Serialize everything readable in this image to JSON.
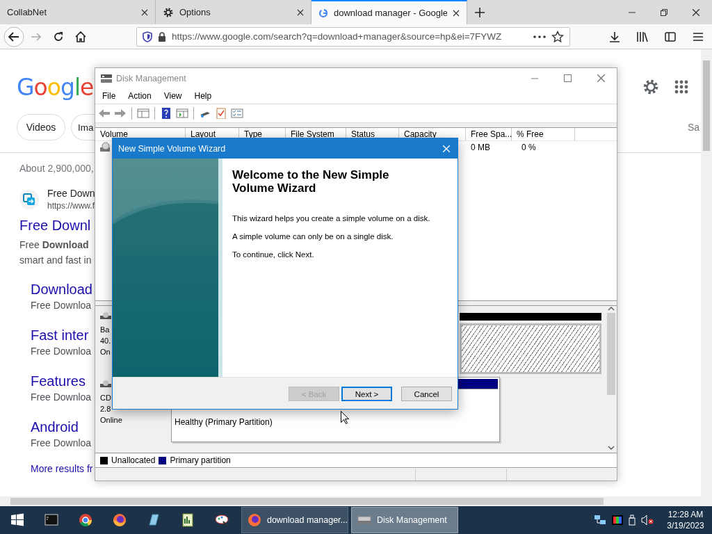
{
  "browser": {
    "tabs": [
      {
        "label": "CollabNet",
        "selected": false
      },
      {
        "label": "Options",
        "selected": false
      },
      {
        "label": "download manager - Google",
        "selected": true
      }
    ],
    "url": "https://www.google.com/search?q=download+manager&source=hp&ei=7FYWZ",
    "page": {
      "logo": "Google",
      "chips": [
        "Videos",
        "Ima"
      ],
      "chip_right": "Sa",
      "result_stats": "About 2,900,000,",
      "result": {
        "site_name": "Free Down",
        "site_url": "https://www.f",
        "title": "Free Downl",
        "snippet": [
          "Free **Download**",
          "smart and fast in"
        ]
      },
      "sitelinks": [
        {
          "title": "Download",
          "snippet": "Free Downloa"
        },
        {
          "title": "Fast inter",
          "snippet": "Free Downloa"
        },
        {
          "title": "Features",
          "snippet": "Free Downloa"
        },
        {
          "title": "Android",
          "snippet": "Free Downloa"
        }
      ],
      "more_results": "More results fr"
    }
  },
  "disk_management": {
    "title": "Disk Management",
    "active": false,
    "menu": [
      "File",
      "Action",
      "View",
      "Help"
    ],
    "columns": [
      "Volume",
      "Layout",
      "Type",
      "File System",
      "Status",
      "Capacity",
      "Free Spa...",
      "% Free"
    ],
    "rows": [
      {
        "free_space": "0 MB",
        "percent_free": "0 %"
      }
    ],
    "disks": [
      {
        "lines": [
          "Ba",
          "40.",
          "On"
        ],
        "partitions": [
          {
            "kind": "unallocated"
          }
        ]
      },
      {
        "lines": [
          "CD",
          "2.8",
          "Online"
        ],
        "partitions": [
          {
            "kind": "primary",
            "status": "Healthy (Primary Partition)"
          }
        ]
      }
    ],
    "legend": [
      {
        "label": "Unallocated",
        "color": "#000000"
      },
      {
        "label": "Primary partition",
        "color": "#000080"
      }
    ]
  },
  "wizard": {
    "title": "New Simple Volume Wizard",
    "heading": "Welcome to the New Simple Volume Wizard",
    "paragraphs": [
      "This wizard helps you create a simple volume on a disk.",
      "A simple volume can only be on a single disk.",
      "To continue, click Next."
    ],
    "buttons": [
      {
        "label": "< Back",
        "disabled": true,
        "default": false
      },
      {
        "label": "Next >",
        "disabled": false,
        "default": true
      },
      {
        "label": "Cancel",
        "disabled": false,
        "default": false
      }
    ]
  },
  "taskbar": {
    "tasks": [
      {
        "label": "download manager...",
        "selected": false
      },
      {
        "label": "Disk Management",
        "selected": true
      }
    ],
    "time": "12:28 AM",
    "date": "3/19/2023"
  }
}
